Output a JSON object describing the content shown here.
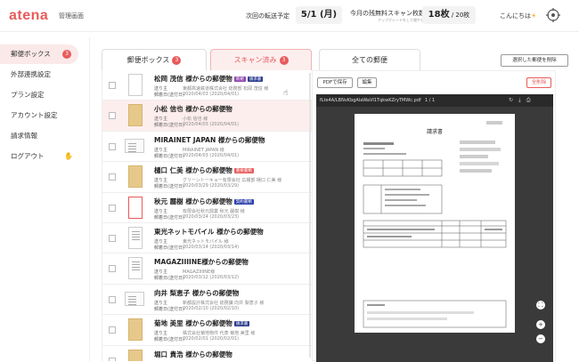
{
  "header": {
    "logo": "atena",
    "admin": "管理画面",
    "next_label": "次回の転送予定",
    "next_date": "5/1 (月)",
    "free_label": "今月の残無料スキャン枚数",
    "free_sub": "アップグレードをして増やす",
    "free_count": "18枚",
    "free_total": " / 20枚",
    "greet": "こんにちは",
    "sun": "☀"
  },
  "sidebar": {
    "items": [
      {
        "label": "郵便ボックス",
        "badge": "3"
      },
      {
        "label": "外部連携設定"
      },
      {
        "label": "プラン設定"
      },
      {
        "label": "アカウント設定"
      },
      {
        "label": "請求情報"
      },
      {
        "label": "ログアウト",
        "icon": "✋"
      }
    ]
  },
  "tabs": [
    {
      "label": "郵便ボックス",
      "badge": "3"
    },
    {
      "label": "スキャン済み",
      "badge": "3"
    },
    {
      "label": "全ての郵便"
    }
  ],
  "delete_button": "選択した郵便を削除",
  "labels": {
    "from": "送り主",
    "date": "郵着日(送付日)"
  },
  "rows": [
    {
      "title": "松岡 茂信 様からの郵便物",
      "tags": [
        {
          "t": "新規",
          "c": "#8e44ad"
        },
        {
          "t": "請求書",
          "c": "#2c3e8f"
        }
      ],
      "sender": "東都高速鉄道株式会社 総務部 松岡 茂信 様",
      "date": "2020/04/03 (2020/04/01)"
    },
    {
      "title": "小松 信也 様からの郵便物",
      "tags": [],
      "sender": "小松 信也 様",
      "date": "2020/04/03 (2020/04/01)"
    },
    {
      "title": "MIRAINET JAPAN 様からの郵便物",
      "tags": [],
      "sender": "MIRAINET JAPAN 様",
      "date": "2020/04/03 (2020/04/01)"
    },
    {
      "title": "樋口 仁美 様からの郵便物",
      "tags": [
        {
          "t": "重要書類",
          "c": "#e85a5a"
        }
      ],
      "sender": "グリーントーキョー有限会社 広報部 樋口 仁美 様",
      "date": "2020/03/29 (2020/03/29)"
    },
    {
      "title": "秋元 麗樹 様からの郵便物",
      "tags": [
        {
          "t": "契約書類",
          "c": "#2c3ea8"
        }
      ],
      "sender": "有限会社秋元興業 秋元 麗樹 様",
      "date": "2020/03/24 (2020/03/23)"
    },
    {
      "title": "東光ネットモバイル 様からの郵便物",
      "tags": [],
      "sender": "東光ネットモバイル 様",
      "date": "2020/03/14 (2020/03/14)"
    },
    {
      "title": "MAGAZIIIINE様からの郵便物",
      "tags": [],
      "sender": "MAGAZIIIINE様",
      "date": "2020/03/12 (2020/03/12)"
    },
    {
      "title": "向井 梨恵子 様からの郵便物",
      "tags": [],
      "sender": "新都設計株式会社 総務課 向井 梨恵子 様",
      "date": "2020/02/10 (2020/02/10)"
    },
    {
      "title": "菊地 美里 様からの郵便物",
      "tags": [
        {
          "t": "請求書",
          "c": "#2c3e8f"
        }
      ],
      "sender": "株式会社菊地物件 代表 菊地 美里 様",
      "date": "2020/02/01 (2020/02/01)"
    },
    {
      "title": "堀口 貴浩 様からの郵便物",
      "tags": [],
      "sender": "",
      "date": ""
    }
  ],
  "viewer": {
    "save_pdf": "PDFで保存",
    "edit": "編集",
    "delete": "全削除",
    "filename": "fLte4A/LBNvKbgAlaWaVI1TqkwKZryTMWc.pdf",
    "page": "1 / 1",
    "doc_title": "請求書",
    "zoom_fit": "⛶",
    "zoom_in": "+",
    "zoom_out": "−"
  }
}
